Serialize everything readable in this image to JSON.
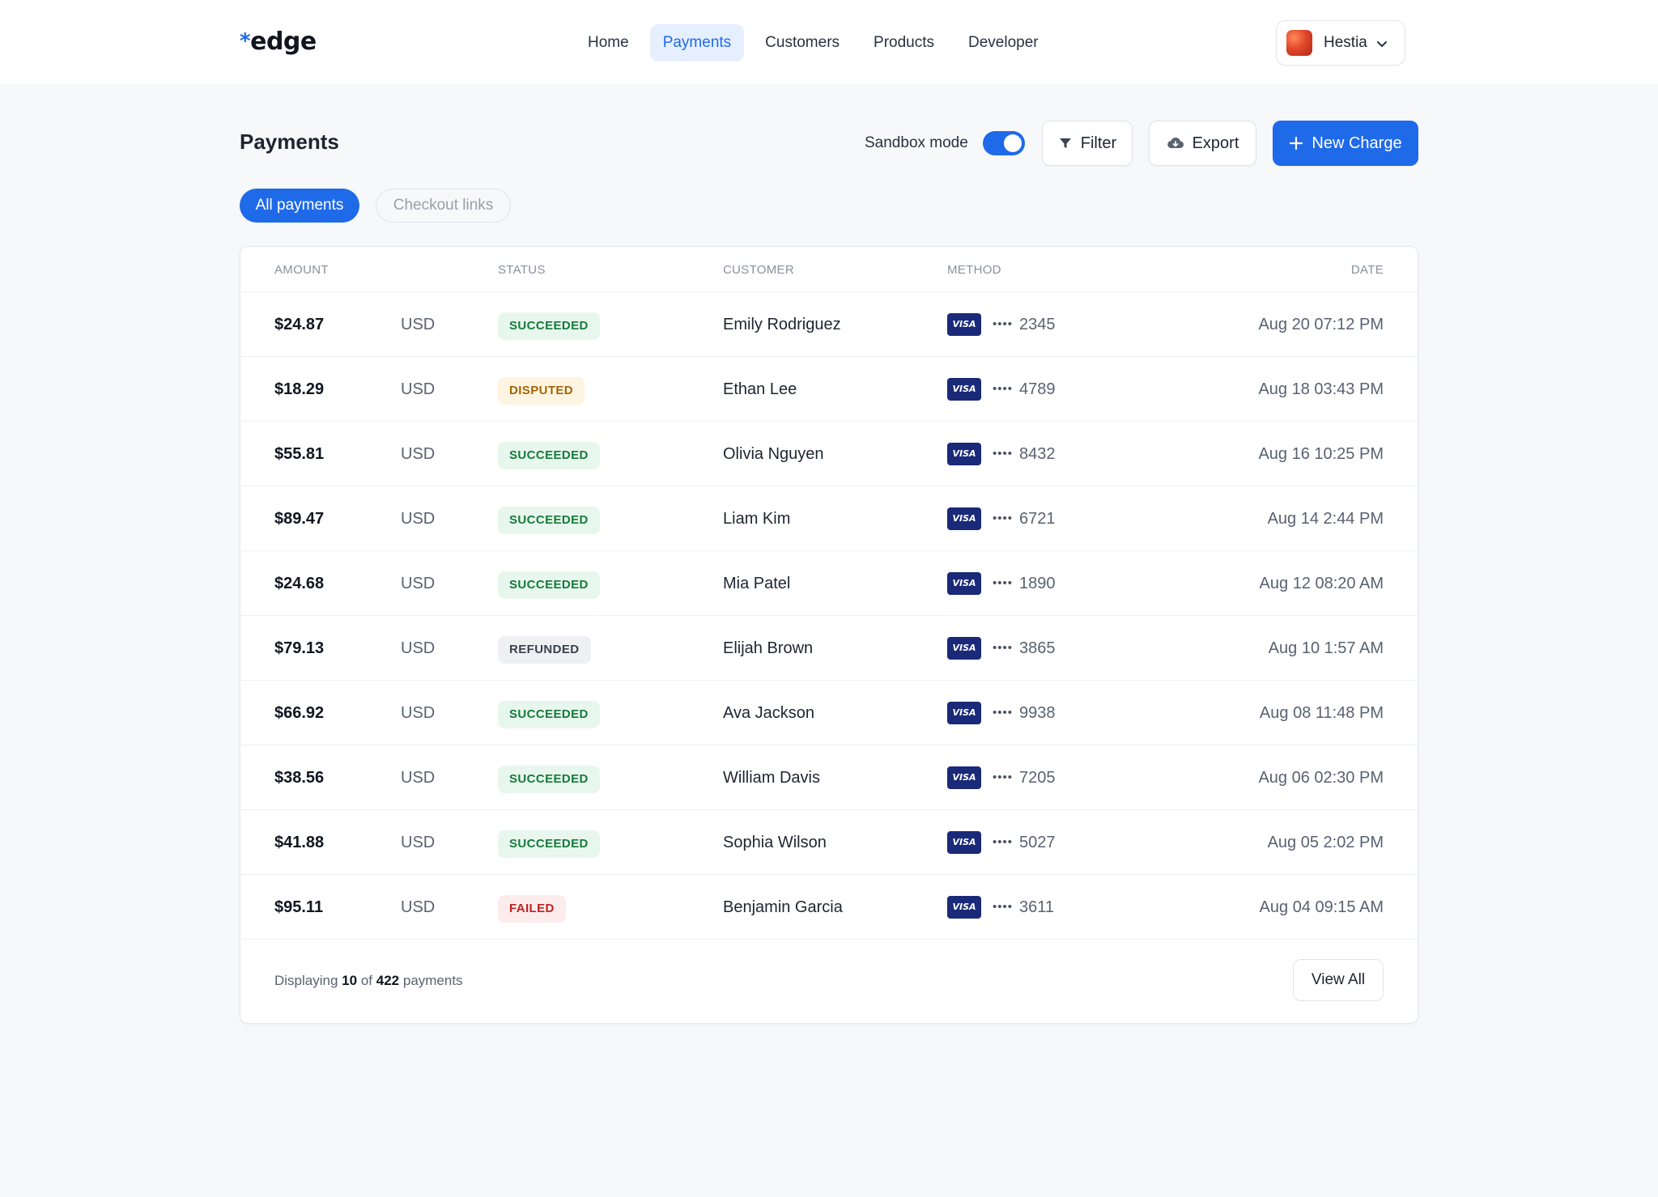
{
  "header": {
    "logo_text": "edge",
    "nav": [
      {
        "label": "Home",
        "active": false
      },
      {
        "label": "Payments",
        "active": true
      },
      {
        "label": "Customers",
        "active": false
      },
      {
        "label": "Products",
        "active": false
      },
      {
        "label": "Developer",
        "active": false
      }
    ],
    "account_name": "Hestia"
  },
  "page": {
    "title": "Payments",
    "sandbox_label": "Sandbox mode",
    "sandbox_on": true,
    "filter_label": "Filter",
    "export_label": "Export",
    "new_charge_label": "New Charge"
  },
  "tabs": [
    {
      "label": "All payments",
      "active": true
    },
    {
      "label": "Checkout links",
      "active": false
    }
  ],
  "table": {
    "columns": {
      "amount": "AMOUNT",
      "status": "STATUS",
      "customer": "CUSTOMER",
      "method": "METHOD",
      "date": "DATE"
    },
    "rows": [
      {
        "amount": "$24.87",
        "currency": "USD",
        "status": "SUCCEEDED",
        "customer": "Emily Rodriguez",
        "card_brand": "VISA",
        "masked": "••••",
        "last4": "2345",
        "date": "Aug 20 07:12 PM"
      },
      {
        "amount": "$18.29",
        "currency": "USD",
        "status": "DISPUTED",
        "customer": "Ethan Lee",
        "card_brand": "VISA",
        "masked": "••••",
        "last4": "4789",
        "date": "Aug 18 03:43 PM"
      },
      {
        "amount": "$55.81",
        "currency": "USD",
        "status": "SUCCEEDED",
        "customer": "Olivia Nguyen",
        "card_brand": "VISA",
        "masked": "••••",
        "last4": "8432",
        "date": "Aug 16 10:25 PM"
      },
      {
        "amount": "$89.47",
        "currency": "USD",
        "status": "SUCCEEDED",
        "customer": "Liam Kim",
        "card_brand": "VISA",
        "masked": "••••",
        "last4": "6721",
        "date": "Aug 14 2:44 PM"
      },
      {
        "amount": "$24.68",
        "currency": "USD",
        "status": "SUCCEEDED",
        "customer": "Mia Patel",
        "card_brand": "VISA",
        "masked": "••••",
        "last4": "1890",
        "date": "Aug 12 08:20 AM"
      },
      {
        "amount": "$79.13",
        "currency": "USD",
        "status": "REFUNDED",
        "customer": "Elijah Brown",
        "card_brand": "VISA",
        "masked": "••••",
        "last4": "3865",
        "date": "Aug 10 1:57 AM"
      },
      {
        "amount": "$66.92",
        "currency": "USD",
        "status": "SUCCEEDED",
        "customer": "Ava Jackson",
        "card_brand": "VISA",
        "masked": "••••",
        "last4": "9938",
        "date": "Aug 08 11:48 PM"
      },
      {
        "amount": "$38.56",
        "currency": "USD",
        "status": "SUCCEEDED",
        "customer": "William Davis",
        "card_brand": "VISA",
        "masked": "••••",
        "last4": "7205",
        "date": "Aug 06 02:30 PM"
      },
      {
        "amount": "$41.88",
        "currency": "USD",
        "status": "SUCCEEDED",
        "customer": "Sophia Wilson",
        "card_brand": "VISA",
        "masked": "••••",
        "last4": "5027",
        "date": "Aug 05 2:02 PM"
      },
      {
        "amount": "$95.11",
        "currency": "USD",
        "status": "FAILED",
        "customer": "Benjamin Garcia",
        "card_brand": "VISA",
        "masked": "••••",
        "last4": "3611",
        "date": "Aug 04 09:15 AM"
      }
    ]
  },
  "footer": {
    "prefix": "Displaying",
    "shown": "10",
    "of": "of",
    "total": "422",
    "suffix": "payments",
    "view_all_label": "View All"
  },
  "colors": {
    "accent": "#1f6ae8",
    "succeeded": "#167a3a",
    "disputed": "#a36507",
    "refunded": "#3a414e",
    "failed": "#c21f1f"
  }
}
